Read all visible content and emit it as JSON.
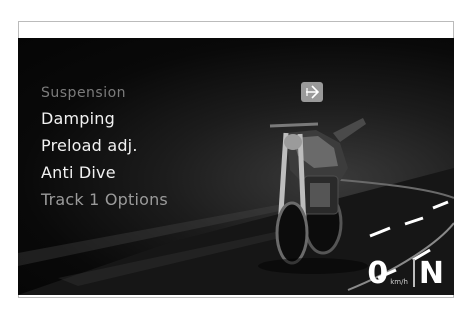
{
  "menu": {
    "header": "Suspension",
    "items": [
      {
        "label": "Damping"
      },
      {
        "label": "Preload adj."
      },
      {
        "label": "Anti Dive"
      },
      {
        "label": "Track 1 Options"
      }
    ]
  },
  "back_button": {
    "icon": "back-arrow-icon"
  },
  "status": {
    "speed": "0",
    "speed_unit": "km/h",
    "gear": "N"
  },
  "colors": {
    "screen_bg": "#0a0a0a",
    "menu_text": "#f2f2f2",
    "header_text": "#7c7c7c"
  }
}
